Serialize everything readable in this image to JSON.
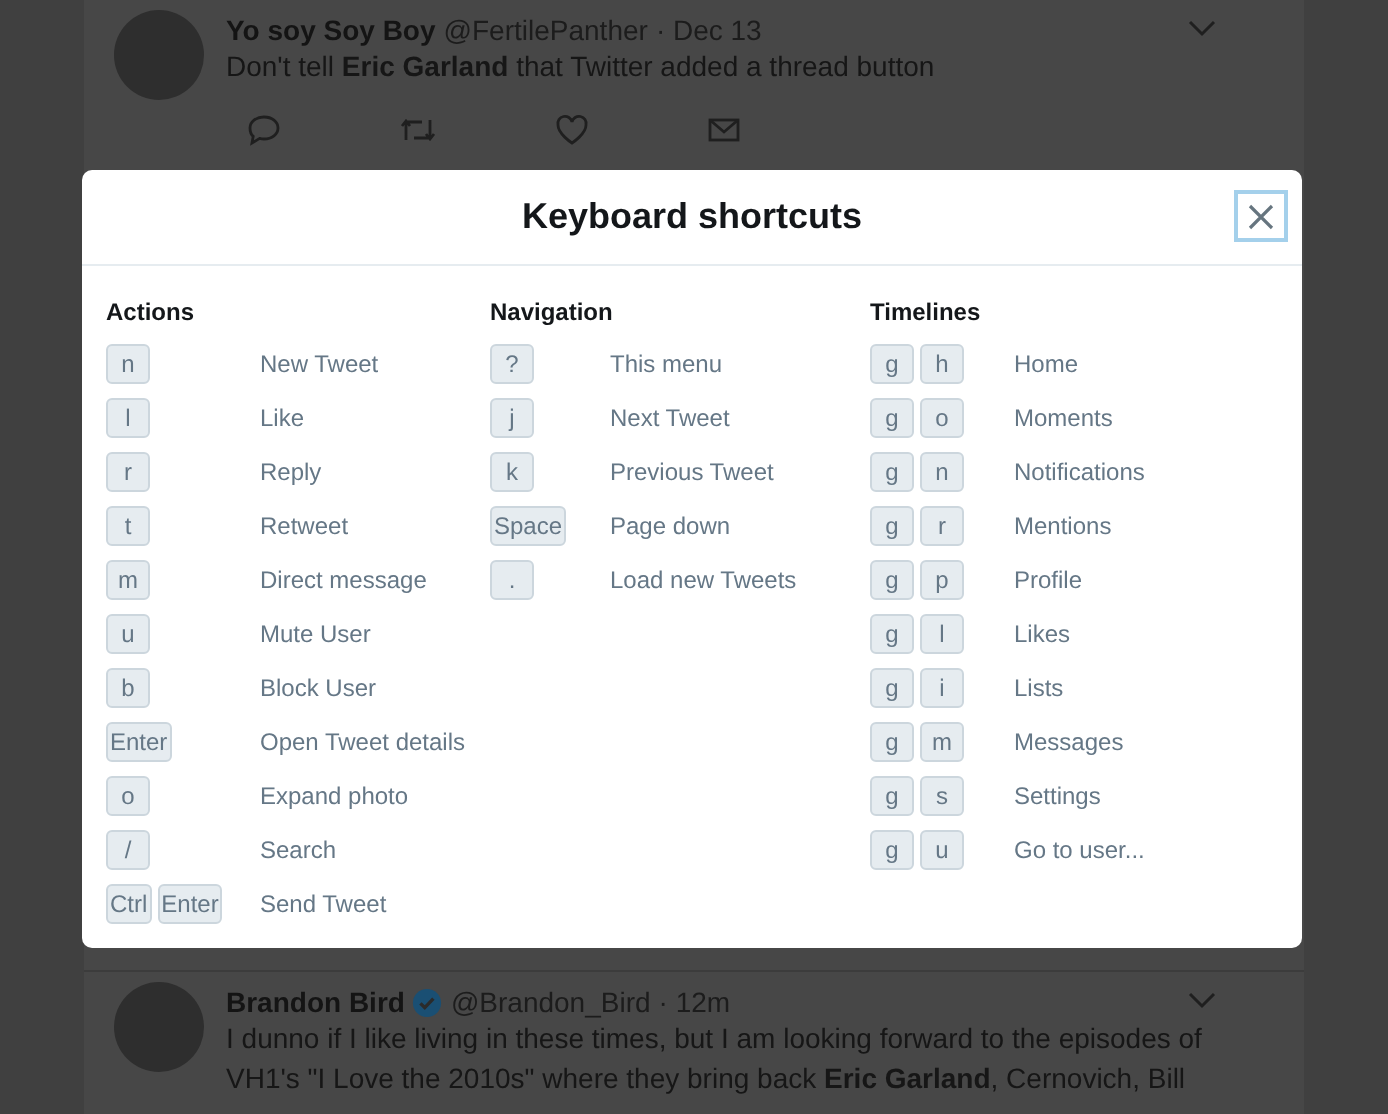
{
  "tweets": [
    {
      "name": "Yo soy Soy Boy",
      "handle": "@FertilePanther",
      "time": "· Dec 13",
      "verified": false,
      "text": [
        "Don't tell **Eric Garland** that Twitter added a thread button"
      ],
      "actions": true
    },
    {
      "name": "Brandon Bird",
      "handle": "@Brandon_Bird",
      "time": "· 12m",
      "verified": true,
      "text": [
        "I dunno if I like living in these times, but I am looking forward to the episodes of",
        "VH1's \"I Love the 2010s\" where they bring back **Eric Garland**, Cernovich, Bill"
      ],
      "actions": false
    }
  ],
  "dialog": {
    "title": "Keyboard shortcuts",
    "sections": [
      {
        "title": "Actions",
        "shortcuts": [
          {
            "keys": [
              "n"
            ],
            "action": "New Tweet"
          },
          {
            "keys": [
              "l"
            ],
            "action": "Like"
          },
          {
            "keys": [
              "r"
            ],
            "action": "Reply"
          },
          {
            "keys": [
              "t"
            ],
            "action": "Retweet"
          },
          {
            "keys": [
              "m"
            ],
            "action": "Direct message"
          },
          {
            "keys": [
              "u"
            ],
            "action": "Mute User"
          },
          {
            "keys": [
              "b"
            ],
            "action": "Block User"
          },
          {
            "keys": [
              "Enter"
            ],
            "action": "Open Tweet details"
          },
          {
            "keys": [
              "o"
            ],
            "action": "Expand photo"
          },
          {
            "keys": [
              "/"
            ],
            "action": "Search"
          },
          {
            "keys": [
              "Ctrl",
              "Enter"
            ],
            "action": "Send Tweet"
          }
        ]
      },
      {
        "title": "Navigation",
        "shortcuts": [
          {
            "keys": [
              "?"
            ],
            "action": "This menu"
          },
          {
            "keys": [
              "j"
            ],
            "action": "Next Tweet"
          },
          {
            "keys": [
              "k"
            ],
            "action": "Previous Tweet"
          },
          {
            "keys": [
              "Space"
            ],
            "action": "Page down"
          },
          {
            "keys": [
              "."
            ],
            "action": "Load new Tweets"
          }
        ]
      },
      {
        "title": "Timelines",
        "shortcuts": [
          {
            "keys": [
              "g",
              "h"
            ],
            "action": "Home"
          },
          {
            "keys": [
              "g",
              "o"
            ],
            "action": "Moments"
          },
          {
            "keys": [
              "g",
              "n"
            ],
            "action": "Notifications"
          },
          {
            "keys": [
              "g",
              "r"
            ],
            "action": "Mentions"
          },
          {
            "keys": [
              "g",
              "p"
            ],
            "action": "Profile"
          },
          {
            "keys": [
              "g",
              "l"
            ],
            "action": "Likes"
          },
          {
            "keys": [
              "g",
              "i"
            ],
            "action": "Lists"
          },
          {
            "keys": [
              "g",
              "m"
            ],
            "action": "Messages"
          },
          {
            "keys": [
              "g",
              "s"
            ],
            "action": "Settings"
          },
          {
            "keys": [
              "g",
              "u"
            ],
            "action": "Go to user..."
          }
        ]
      }
    ]
  }
}
